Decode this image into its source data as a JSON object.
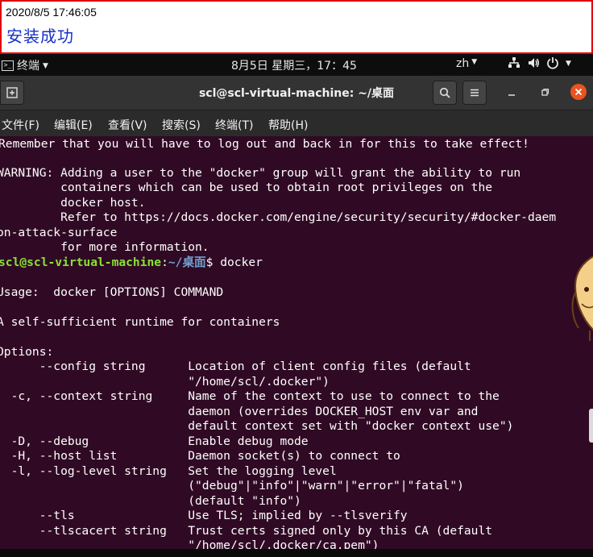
{
  "annotation": {
    "timestamp": "2020/8/5 17:46:05",
    "message": "安装成功"
  },
  "topbar": {
    "app_label": "终端",
    "clock": "8月5日 星期三，17：45",
    "input_method": "zh"
  },
  "window": {
    "title": "scl@scl-virtual-machine: ~/桌面"
  },
  "menu": [
    "文件(F)",
    "编辑(E)",
    "查看(V)",
    "搜索(S)",
    "终端(T)",
    "帮助(H)"
  ],
  "colors": {
    "terminal_bg": "#300a24",
    "prompt_user": "#8ae234",
    "prompt_path": "#729fcf",
    "close_button": "#e95420",
    "annotation_border": "#e00000",
    "annotation_text": "#1530c8"
  },
  "terminal": {
    "lines": [
      "Remember that you will have to log out and back in for this to take effect!",
      "",
      "WARNING: Adding a user to the \"docker\" group will grant the ability to run",
      "         containers which can be used to obtain root privileges on the",
      "         docker host.",
      "         Refer to https://docs.docker.com/engine/security/security/#docker-daem",
      "on-attack-surface",
      "         for more information.",
      "",
      "",
      "Usage:  docker [OPTIONS] COMMAND",
      "",
      "A self-sufficient runtime for containers",
      "",
      "Options:",
      "      --config string      Location of client config files (default",
      "                           \"/home/scl/.docker\")",
      "  -c, --context string     Name of the context to use to connect to the",
      "                           daemon (overrides DOCKER_HOST env var and",
      "                           default context set with \"docker context use\")",
      "  -D, --debug              Enable debug mode",
      "  -H, --host list          Daemon socket(s) to connect to",
      "  -l, --log-level string   Set the logging level",
      "                           (\"debug\"|\"info\"|\"warn\"|\"error\"|\"fatal\")",
      "                           (default \"info\")",
      "      --tls                Use TLS; implied by --tlsverify",
      "      --tlscacert string   Trust certs signed only by this CA (default",
      "                           \"/home/scl/.docker/ca.pem\")"
    ],
    "prompt": {
      "user_host": "scl@scl-virtual-machine",
      "separator": ":",
      "path": "~/桌面",
      "symbol": "$ ",
      "command": "docker"
    }
  }
}
